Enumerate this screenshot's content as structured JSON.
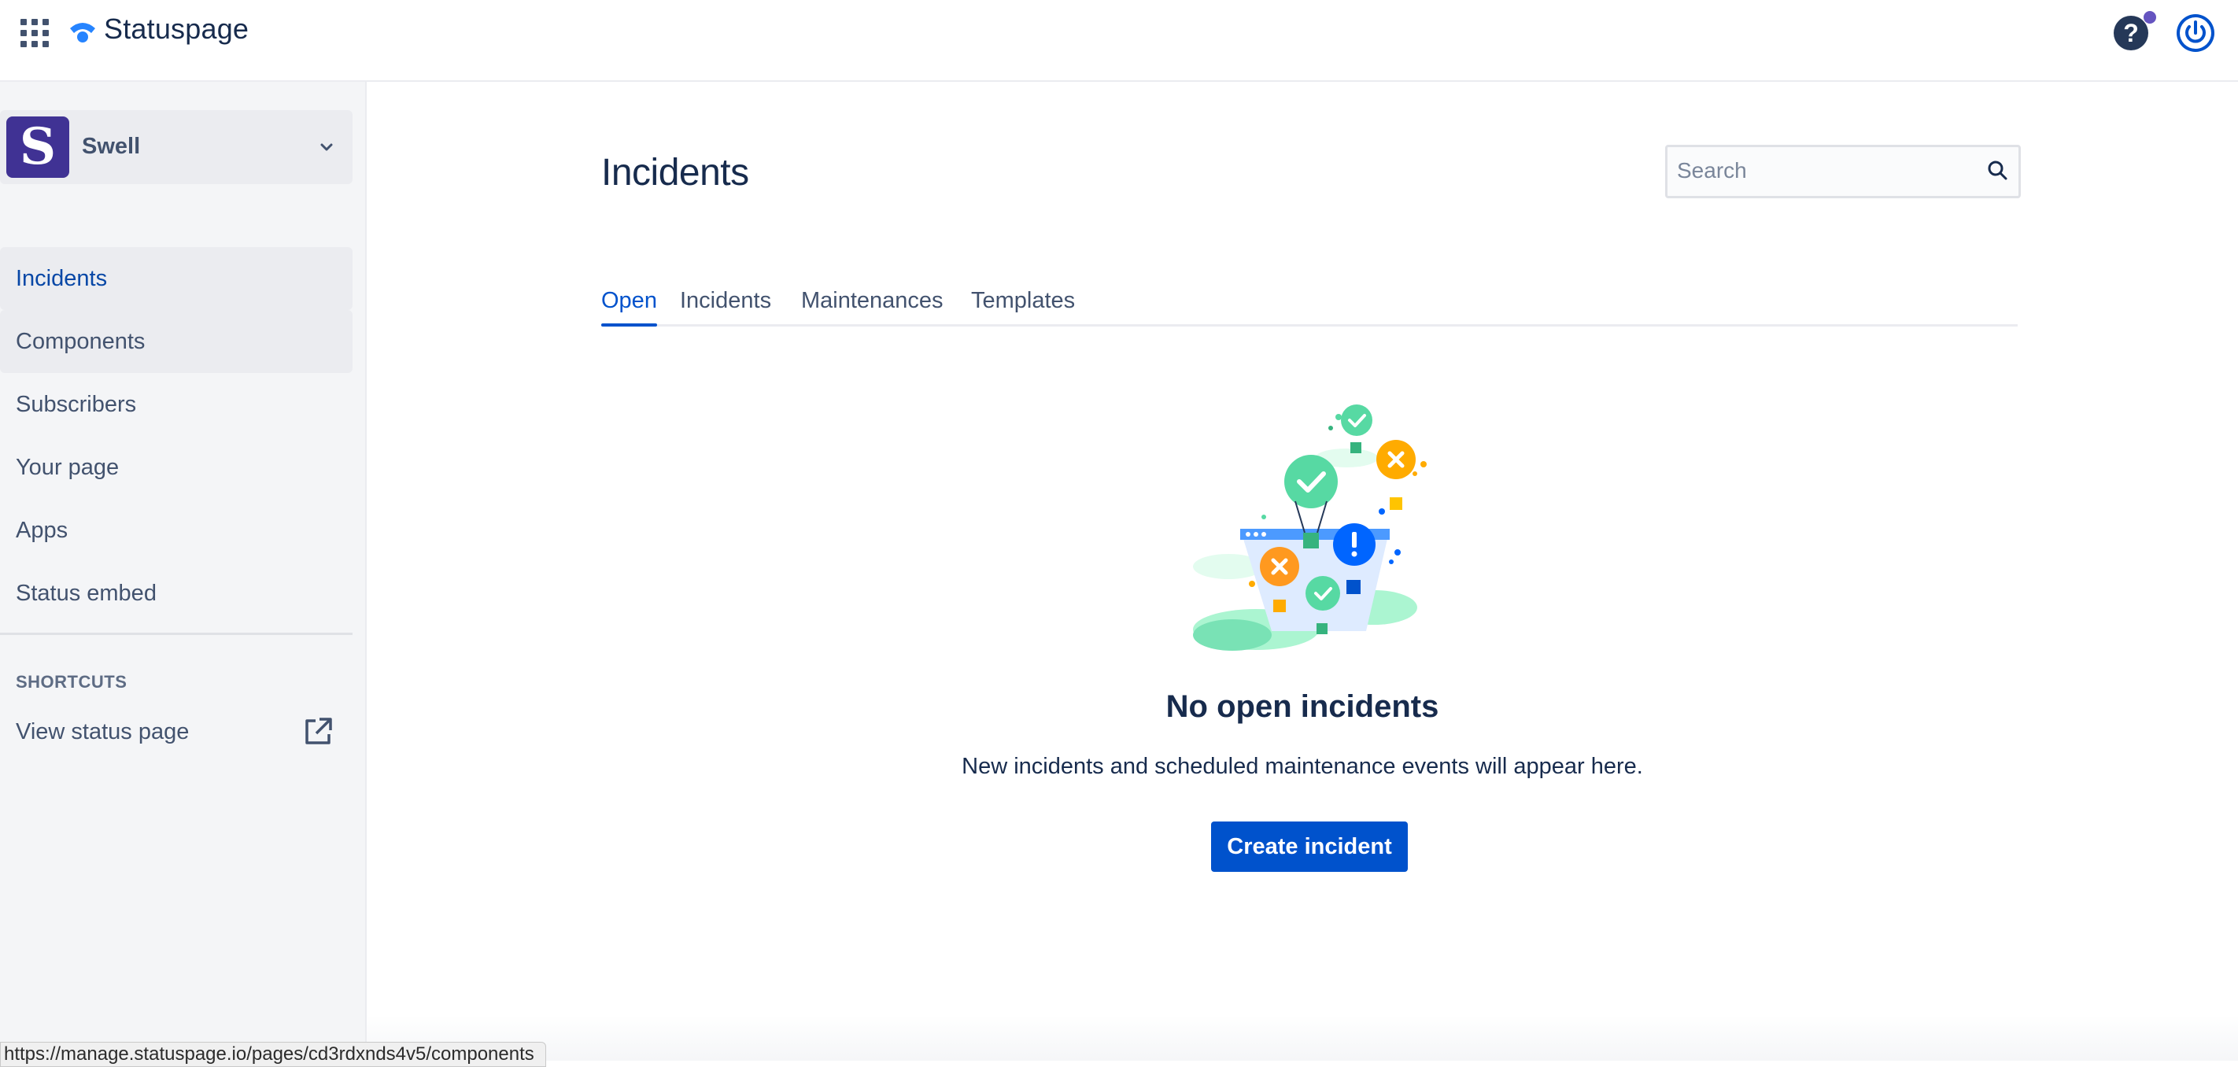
{
  "header": {
    "app_switcher_icon": "grid-dots-icon",
    "logo_text": "Statuspage",
    "help_icon": "question-icon",
    "help_symbol": "?",
    "power_icon": "power-icon",
    "accent_color": "#0052cc"
  },
  "sidebar": {
    "project": {
      "avatar_letter": "S",
      "name": "Swell",
      "avatar_color": "#403294"
    },
    "items": [
      {
        "label": "Incidents",
        "active": true
      },
      {
        "label": "Components",
        "hovered": true
      },
      {
        "label": "Subscribers"
      },
      {
        "label": "Your page"
      },
      {
        "label": "Apps"
      },
      {
        "label": "Status embed"
      }
    ],
    "shortcuts_title": "SHORTCUTS",
    "shortcuts": [
      {
        "label": "View status page",
        "icon": "external-link-icon"
      }
    ]
  },
  "main": {
    "title": "Incidents",
    "search": {
      "placeholder": "Search",
      "value": ""
    },
    "tabs": [
      {
        "label": "Open",
        "active": true
      },
      {
        "label": "Incidents"
      },
      {
        "label": "Maintenances"
      },
      {
        "label": "Templates"
      }
    ],
    "empty_state": {
      "title": "No open incidents",
      "description": "New incidents and scheduled maintenance events will appear here.",
      "button_label": "Create incident"
    }
  },
  "status_bar": {
    "url": "https://manage.statuspage.io/pages/cd3rdxnds4v5/components"
  }
}
